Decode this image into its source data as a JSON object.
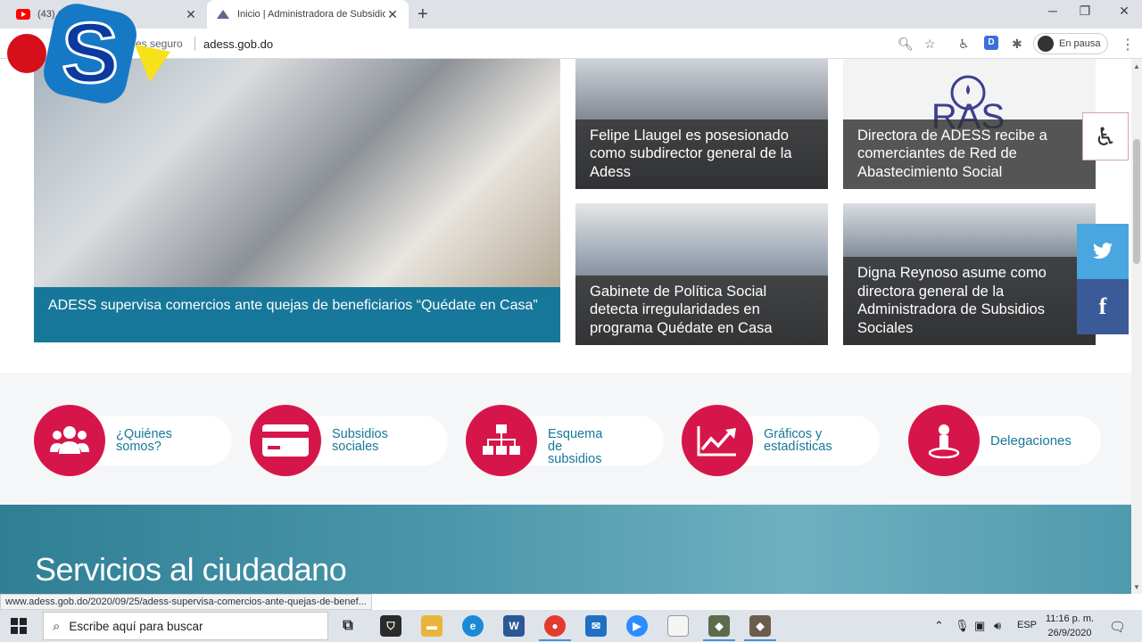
{
  "browser": {
    "tabs": [
      {
        "title": "(43) G...",
        "active": false,
        "favicon": "youtube-icon"
      },
      {
        "title": "Inicio | Administradora de Subsidios",
        "active": true,
        "favicon": "site-icon"
      }
    ],
    "security_text": "es seguro",
    "url": "adess.gob.do",
    "profile_label": "En pausa",
    "extension_badge": "D"
  },
  "featured_news": {
    "caption": "ADESS supervisa comercios ante quejas de beneficiarios “Quédate en Casa”"
  },
  "news": [
    {
      "caption": "Felipe Llaugel es posesionado como subdirector general de la Adess"
    },
    {
      "caption": "Directora de ADESS recibe a comerciantes de Red de Abastecimiento Social",
      "logo_text": "RAS"
    },
    {
      "caption": "Gabinete de Política Social detecta irregularidades en programa Quédate en Casa"
    },
    {
      "caption": "Digna Reynoso asume como directora general de la Administradora de Subsidios Sociales"
    }
  ],
  "categories": [
    {
      "line1": "¿Quiénes",
      "line2": "somos?",
      "icon": "users-icon"
    },
    {
      "line1": "Subsidios",
      "line2": "sociales",
      "icon": "card-icon"
    },
    {
      "line1": "Esquema de",
      "line2": "subsidios",
      "icon": "org-chart-icon"
    },
    {
      "line1": "Gráficos y",
      "line2": "estadísticas",
      "icon": "chart-icon"
    },
    {
      "line1": "Delegaciones",
      "line2": "",
      "icon": "location-icon"
    }
  ],
  "services_heading": "Servicios al ciudadano",
  "status_url": "www.adess.gob.do/2020/09/25/adess-supervisa-comercios-ante-quejas-de-benef...",
  "taskbar": {
    "search_placeholder": "Escribe aquí para buscar",
    "language": "ESP",
    "time": "11:16 p. m.",
    "date": "26/9/2020"
  },
  "colors": {
    "brand_red": "#d6164b",
    "brand_blue": "#17779a",
    "twitter": "#4aa6df",
    "facebook": "#3b5a98"
  }
}
